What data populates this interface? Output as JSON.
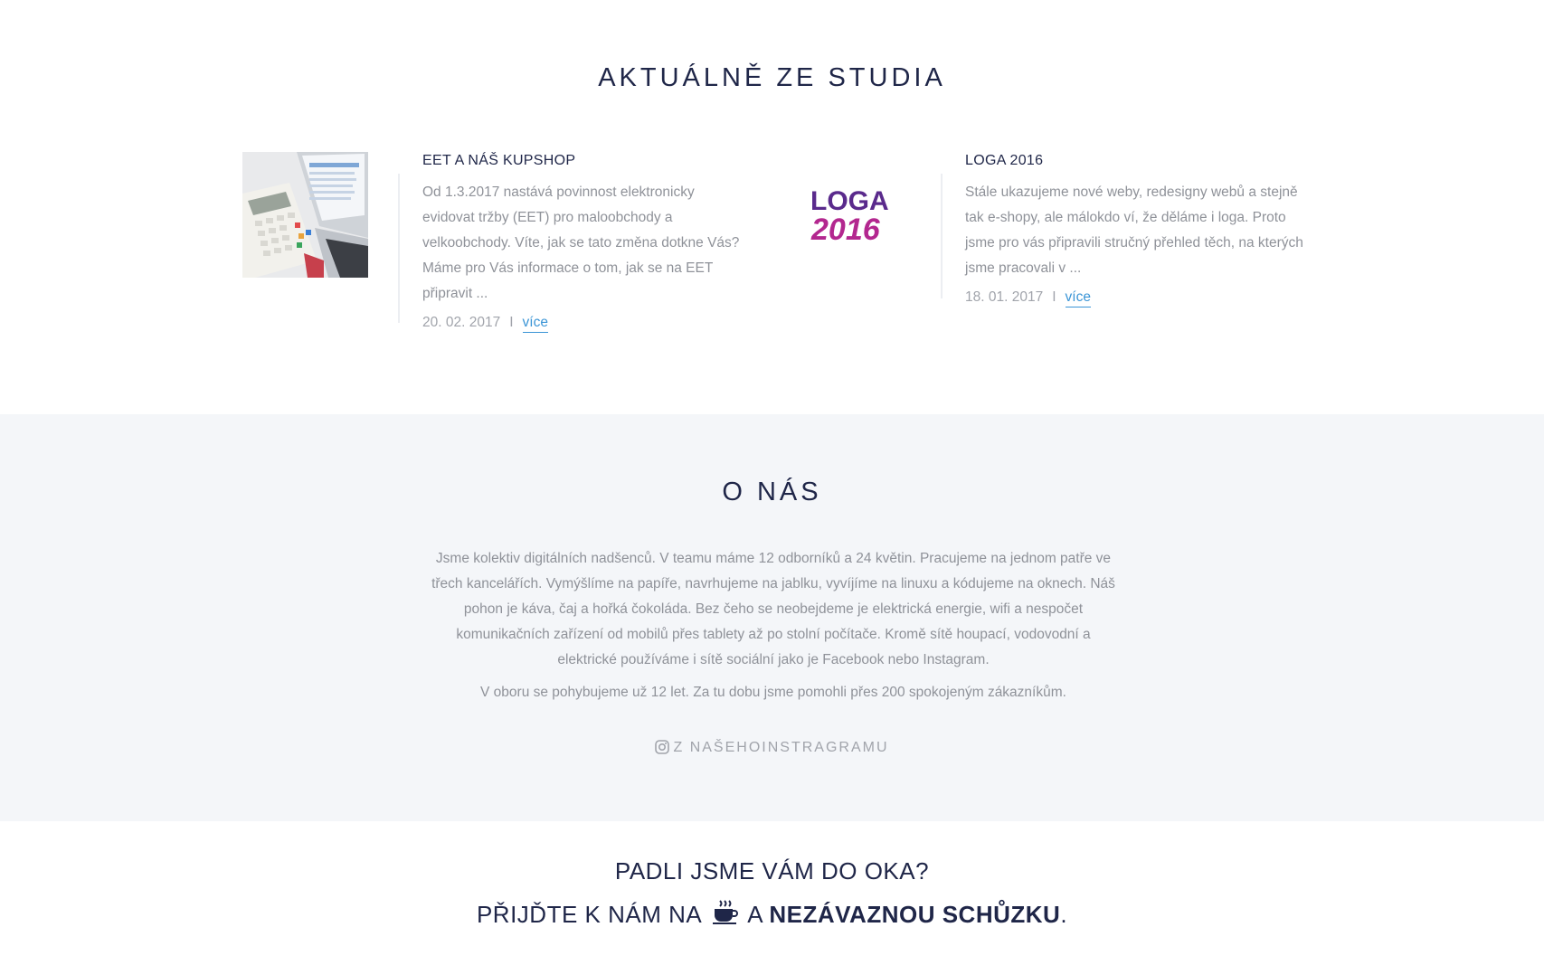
{
  "news": {
    "title": "AKTUÁLNĚ ZE STUDIA",
    "articles": [
      {
        "title": "EET A NÁŠ KUPSHOP",
        "excerpt": "Od 1.3.2017 nastává povinnost elektronicky evidovat tržby (EET) pro maloobchody a velkoobchody. Víte, jak se tato změna dotkne Vás? Máme pro Vás informace o tom, jak se na EET připravit ...",
        "date": "20. 02. 2017",
        "separator": "I",
        "more": "více"
      },
      {
        "title": "LOGA 2016",
        "excerpt": "Stále ukazujeme nové weby, redesigny webů a stejně tak e-shopy, ale málokdo ví, že děláme i loga. Proto jsme pro vás připravili stručný přehled těch, na kterých jsme pracovali v ...",
        "date": "18. 01. 2017",
        "separator": "I",
        "more": "více",
        "logo_line1": "LOGA",
        "logo_line2": "2016"
      }
    ]
  },
  "about": {
    "title": "O NÁS",
    "paragraph1": "Jsme kolektiv digitálních nadšenců. V teamu máme 12 odborníků a 24 květin. Pracujeme na jednom patře ve třech kancelářích. Vymýšlíme na papíře, navrhujeme na jablku, vyvíjíme na linuxu a kódujeme na oknech. Náš pohon je káva, čaj a hořká čokoláda. Bez čeho se neobejdeme je elektrická energie, wifi a nespočet komunikačních zařízení od mobilů přes tablety až po stolní počítače. Kromě sítě houpací, vodovodní a elektrické používáme i sítě sociální jako je Facebook nebo Instagram.",
    "paragraph2": "V oboru se pohybujeme už 12 let. Za tu dobu jsme pomohli přes 200 spokojeným zákazníkům.",
    "instagram_link": "Z NAŠEHOINSTRAGRAMU"
  },
  "cta": {
    "line1": "PADLI JSME VÁM DO OKA?",
    "line2_prefix": "PŘIJĎTE K NÁM NA",
    "line2_middle": "A",
    "line2_link": "NEZÁVAZNOU SCHŮZKU",
    "line2_suffix": "."
  },
  "colors": {
    "heading": "#1f2648",
    "text": "#8f9299",
    "link": "#3b95d6",
    "about_bg": "#f4f6f9"
  },
  "icons": [
    "calculator-laptop-thumbnail",
    "instagram-icon",
    "coffee-cup-icon"
  ]
}
